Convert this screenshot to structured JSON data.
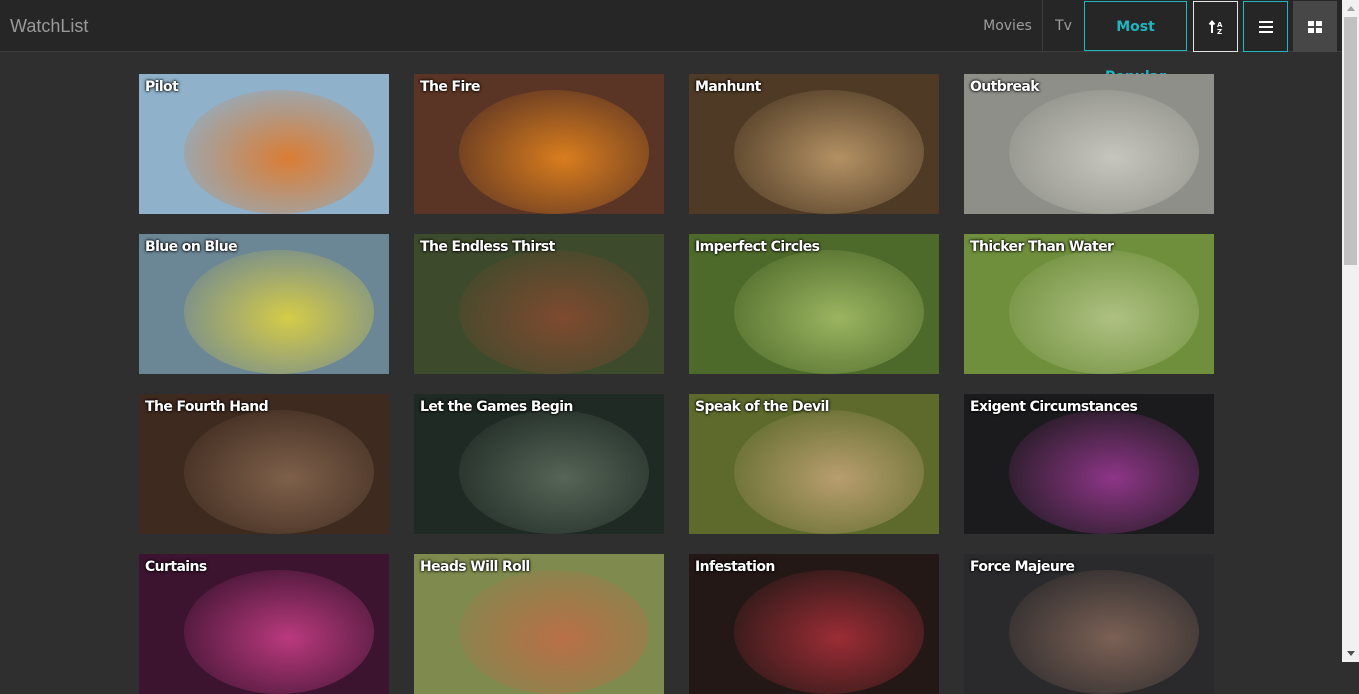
{
  "app": {
    "brand": "WatchList"
  },
  "nav": {
    "movies": "Movies",
    "tv": "Tv",
    "most_popular": "Most Popular",
    "sort_icon": "sort-alpha-icon",
    "list_icon": "list-view-icon",
    "grid_icon": "grid-view-icon"
  },
  "episodes": [
    {
      "title": "Pilot",
      "bg": "#8fb1c9",
      "accent": "#e8731a"
    },
    {
      "title": "The Fire",
      "bg": "#5a3424",
      "accent": "#f08a1c"
    },
    {
      "title": "Manhunt",
      "bg": "#4e3a25",
      "accent": "#c5a06e"
    },
    {
      "title": "Outbreak",
      "bg": "#8e8f88",
      "accent": "#cfcfc6"
    },
    {
      "title": "Blue on Blue",
      "bg": "#6b8695",
      "accent": "#e8d83a"
    },
    {
      "title": "The Endless Thirst",
      "bg": "#3d4a2c",
      "accent": "#8a4a30"
    },
    {
      "title": "Imperfect Circles",
      "bg": "#4e6a2a",
      "accent": "#a8c26a"
    },
    {
      "title": "Thicker Than Water",
      "bg": "#6f8f3c",
      "accent": "#b9c98e"
    },
    {
      "title": "The Fourth Hand",
      "bg": "#3e2a1f",
      "accent": "#8a6a52"
    },
    {
      "title": "Let the Games Begin",
      "bg": "#1f2a24",
      "accent": "#5f6f60"
    },
    {
      "title": "Speak of the Devil",
      "bg": "#5d6a2c",
      "accent": "#c9a77a"
    },
    {
      "title": "Exigent Circumstances",
      "bg": "#1b1a1c",
      "accent": "#a23a9a"
    },
    {
      "title": "Curtains",
      "bg": "#3c1430",
      "accent": "#d0408c"
    },
    {
      "title": "Heads Will Roll",
      "bg": "#7e8a4e",
      "accent": "#c46a46"
    },
    {
      "title": "Infestation",
      "bg": "#241816",
      "accent": "#b0303a"
    },
    {
      "title": "Force Majeure",
      "bg": "#2a2a2c",
      "accent": "#8a6a5c"
    }
  ]
}
